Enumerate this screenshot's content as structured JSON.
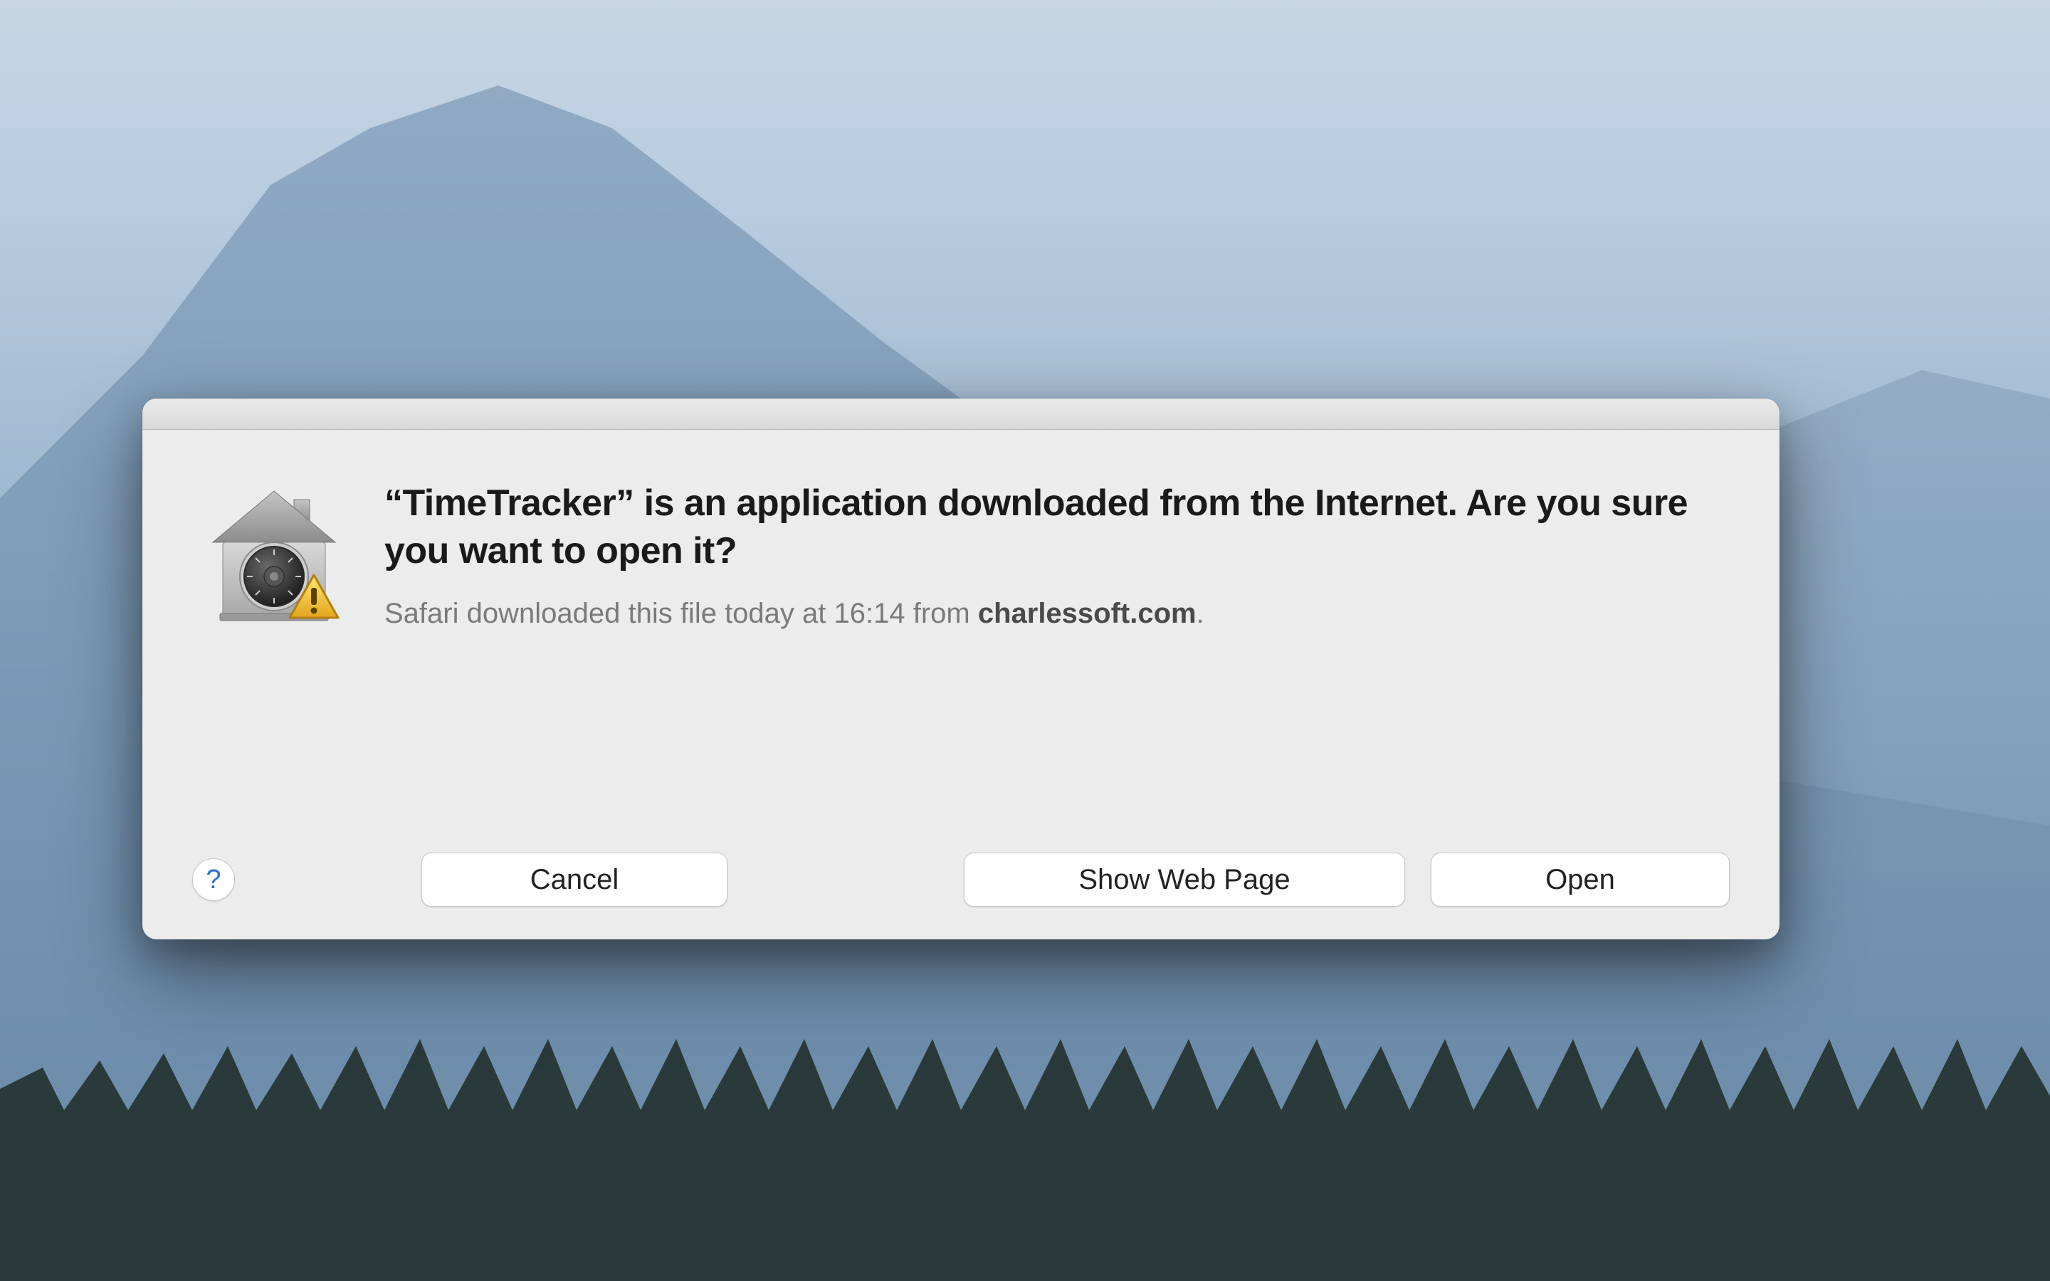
{
  "dialog": {
    "headline": "“TimeTracker” is an application downloaded from the Internet. Are you sure you want to open it?",
    "subtext_prefix": "Safari downloaded this file today at 16:14 from ",
    "subtext_domain": "charlessoft.com",
    "subtext_suffix": ".",
    "help_label": "?",
    "buttons": {
      "cancel": "Cancel",
      "show_web_page": "Show Web Page",
      "open": "Open"
    },
    "icon_name": "gatekeeper-icon",
    "warning_badge": "!"
  }
}
